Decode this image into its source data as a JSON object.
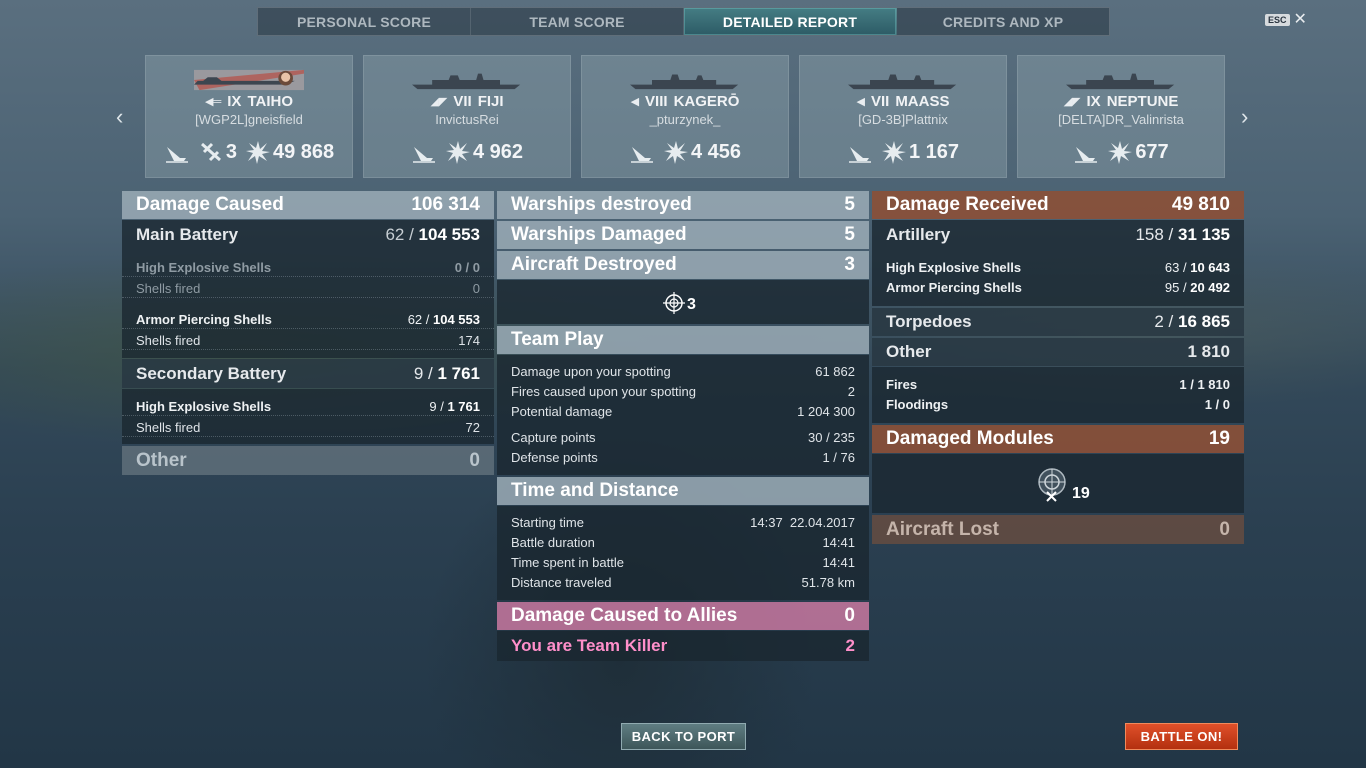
{
  "tabs": [
    "PERSONAL SCORE",
    "TEAM SCORE",
    "DETAILED REPORT",
    "CREDITS AND XP"
  ],
  "active_tab": "DETAILED REPORT",
  "esc": {
    "key": "ESC",
    "close": "✕"
  },
  "nav": {
    "prev": "‹",
    "next": "›"
  },
  "ships": [
    {
      "tier": "IX",
      "name": "TAIHO",
      "player": "[WGP2L]gneisfield",
      "stats": {
        "sunk_icon": "ship-sunk-icon",
        "planes": "3",
        "damage": "49 868"
      }
    },
    {
      "tier": "VII",
      "name": "FIJI",
      "player": "InvictusRei",
      "stats": {
        "damage": "4 962"
      }
    },
    {
      "tier": "VIII",
      "name": "KAGERŌ",
      "player": "_pturzynek_",
      "stats": {
        "damage": "4 456"
      }
    },
    {
      "tier": "VII",
      "name": "MAASS",
      "player": "[GD-3B]Plattnix",
      "stats": {
        "damage": "1 167"
      }
    },
    {
      "tier": "IX",
      "name": "NEPTUNE",
      "player": "[DELTA]DR_Valinrista",
      "stats": {
        "damage": "677"
      }
    }
  ],
  "damage_caused": {
    "title": "Damage Caused",
    "value": "106 314",
    "main_battery": {
      "label": "Main Battery",
      "hits": "62",
      "damage": "104 553"
    },
    "he_shells": {
      "label": "High Explosive Shells",
      "value": "0 / 0"
    },
    "he_fired": {
      "label": "Shells fired",
      "value": "0"
    },
    "ap_shells": {
      "label": "Armor Piercing Shells",
      "hits": "62",
      "damage": "104 553"
    },
    "ap_fired": {
      "label": "Shells fired",
      "value": "174"
    },
    "secondary": {
      "label": "Secondary Battery",
      "hits": "9",
      "damage": "1 761"
    },
    "sec_he": {
      "label": "High Explosive Shells",
      "hits": "9",
      "damage": "1 761"
    },
    "sec_fired": {
      "label": "Shells fired",
      "value": "72"
    },
    "other": {
      "label": "Other",
      "value": "0"
    }
  },
  "middle": {
    "warships_destroyed": {
      "label": "Warships destroyed",
      "value": "5"
    },
    "warships_damaged": {
      "label": "Warships Damaged",
      "value": "5"
    },
    "aircraft_destroyed": {
      "label": "Aircraft Destroyed",
      "value": "3"
    },
    "aircraft_icon_count": "3",
    "team_play": {
      "title": "Team Play",
      "rows": [
        {
          "label": "Damage upon your spotting",
          "value": "61 862"
        },
        {
          "label": "Fires caused upon your spotting",
          "value": "2"
        },
        {
          "label": "Potential damage",
          "value": "1 204 300"
        },
        {
          "label": "Capture points",
          "value": "30 / 235"
        },
        {
          "label": "Defense points",
          "value": "1 / 76"
        }
      ]
    },
    "time_distance": {
      "title": "Time and Distance",
      "rows": [
        {
          "label": "Starting time",
          "value": "14:37  22.04.2017"
        },
        {
          "label": "Battle duration",
          "value": "14:41"
        },
        {
          "label": "Time spent in battle",
          "value": "14:41"
        },
        {
          "label": "Distance traveled",
          "value": "51.78 km"
        }
      ]
    },
    "allies": {
      "label": "Damage Caused to Allies",
      "value": "0"
    },
    "team_killer": {
      "label": "You are Team Killer",
      "value": "2"
    }
  },
  "received": {
    "title": "Damage Received",
    "value": "49 810",
    "artillery": {
      "label": "Artillery",
      "hits": "158",
      "damage": "31 135"
    },
    "he": {
      "label": "High Explosive Shells",
      "hits": "63",
      "damage": "10 643"
    },
    "ap": {
      "label": "Armor Piercing Shells",
      "hits": "95",
      "damage": "20 492"
    },
    "torpedoes": {
      "label": "Torpedoes",
      "hits": "2",
      "damage": "16 865"
    },
    "other": {
      "label": "Other",
      "value": "1 810"
    },
    "fires": {
      "label": "Fires",
      "value": "1 / 1 810"
    },
    "floodings": {
      "label": "Floodings",
      "value": "1 / 0"
    },
    "modules": {
      "label": "Damaged Modules",
      "value": "19"
    },
    "modules_icon_count": "19",
    "aircraft_lost": {
      "label": "Aircraft Lost",
      "value": "0"
    }
  },
  "buttons": {
    "back": "BACK TO PORT",
    "battle": "BATTLE ON!"
  }
}
